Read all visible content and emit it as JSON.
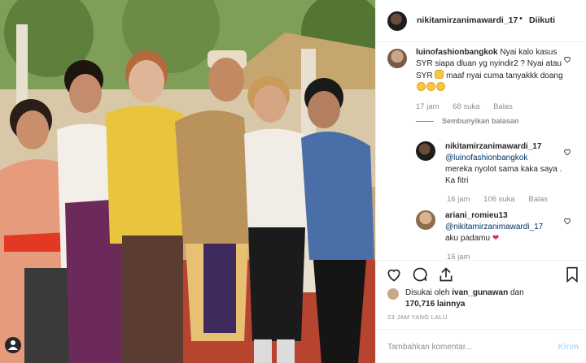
{
  "post": {
    "username": "nikitamirzanimawardi_17",
    "separator": "•",
    "follow_status": "Diikuti"
  },
  "comments": [
    {
      "username": "luinofashionbangkok",
      "text_1": "Nyai kalo kasus SYR siapa dluan yg nyindir2 ? Nyai atau SYR",
      "text_2": "maaf nyai cuma tanyakkk doang",
      "time": "17 jam",
      "likes": "68 suka",
      "reply": "Balas",
      "hide_replies": "Sembunyikan balasan"
    },
    {
      "username": "nikitamirzanimawardi_17",
      "mention": "@luinofashionbangkok",
      "text": "mereka nyolot sama kaka saya . Ka fitri",
      "time": "16 jam",
      "likes": "106 suka",
      "reply": "Balas"
    },
    {
      "username": "ariani_romieu13",
      "mention": "@nikitamirzanimawardi_17",
      "text": "aku padamu",
      "heart": "❤",
      "time": "16 jam"
    }
  ],
  "liked_by": {
    "prefix": "Disukai oleh",
    "user": "ivan_gunawan",
    "joiner": "dan",
    "count": "170,716 lainnya"
  },
  "timestamp": "23 JAM YANG LALU",
  "add_comment": {
    "placeholder": "Tambahkan komentar...",
    "post_label": "Kirim"
  },
  "icons": {
    "like": "heart-icon",
    "comment": "comment-icon",
    "share": "share-icon",
    "save": "bookmark-icon",
    "tag": "person-tag-icon"
  }
}
